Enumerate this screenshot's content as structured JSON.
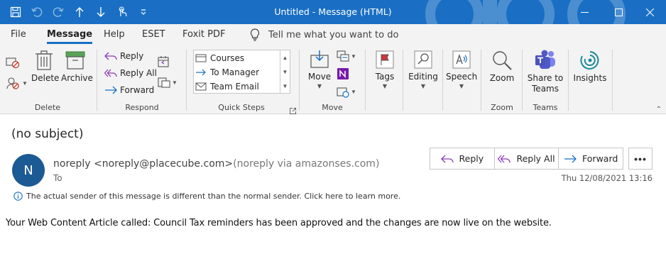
{
  "window": {
    "title": "Untitled  -  Message (HTML)",
    "accent": "#1a6fc4"
  },
  "quick_access": [
    "save-icon",
    "undo-icon",
    "redo-icon",
    "up-arrow-icon",
    "down-arrow-icon",
    "touch-mode-icon",
    "customize-icon"
  ],
  "menu": {
    "tabs": [
      "File",
      "Message",
      "Help",
      "ESET",
      "Foxit PDF"
    ],
    "active": "Message",
    "tell_me": "Tell me what you want to do"
  },
  "ribbon": {
    "delete_group": {
      "label": "Delete",
      "delete": "Delete",
      "archive": "Archive"
    },
    "respond_group": {
      "label": "Respond",
      "reply": "Reply",
      "reply_all": "Reply All",
      "forward": "Forward"
    },
    "quick_steps_group": {
      "label": "Quick Steps",
      "items": [
        "Courses",
        "To Manager",
        "Team Email"
      ]
    },
    "move_group": {
      "label": "Move",
      "move": "Move"
    },
    "tags": "Tags",
    "editing": "Editing",
    "speech": "Speech",
    "zoom_group": {
      "label": "Zoom",
      "zoom": "Zoom"
    },
    "teams_group": {
      "label": "Teams",
      "share_line1": "Share to",
      "share_line2": "Teams"
    },
    "insights": "Insights"
  },
  "message": {
    "subject": "(no subject)",
    "avatar_initial": "N",
    "avatar_color": "#1c5a94",
    "sender": "noreply <noreply@placecube.com>",
    "via": "(noreply via amazonses.com)",
    "to_label": "To",
    "date": "Thu 12/08/2021 13:16",
    "info": "The actual sender of this message is different than the normal sender. Click here to learn more.",
    "body": "Your Web Content Article called: Council Tax reminders has been approved and the changes are now live on the website."
  },
  "actions": {
    "reply": "Reply",
    "reply_all": "Reply All",
    "forward": "Forward",
    "more": "•••"
  }
}
